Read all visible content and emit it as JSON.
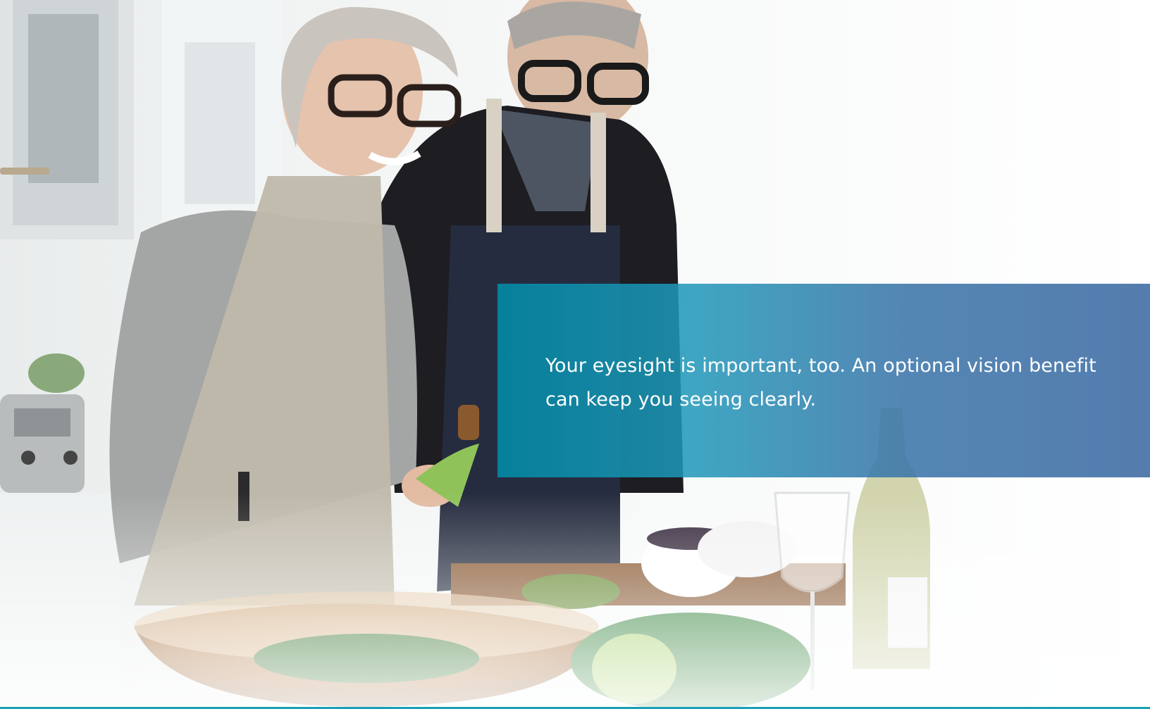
{
  "callout": {
    "text": "Your eyesight is important, too. An optional vision benefit can keep you seeing clearly."
  },
  "colors": {
    "callout_teal": "#008eaa",
    "callout_blue": "#426ea5",
    "accent_rule": "#1aa0b8"
  }
}
